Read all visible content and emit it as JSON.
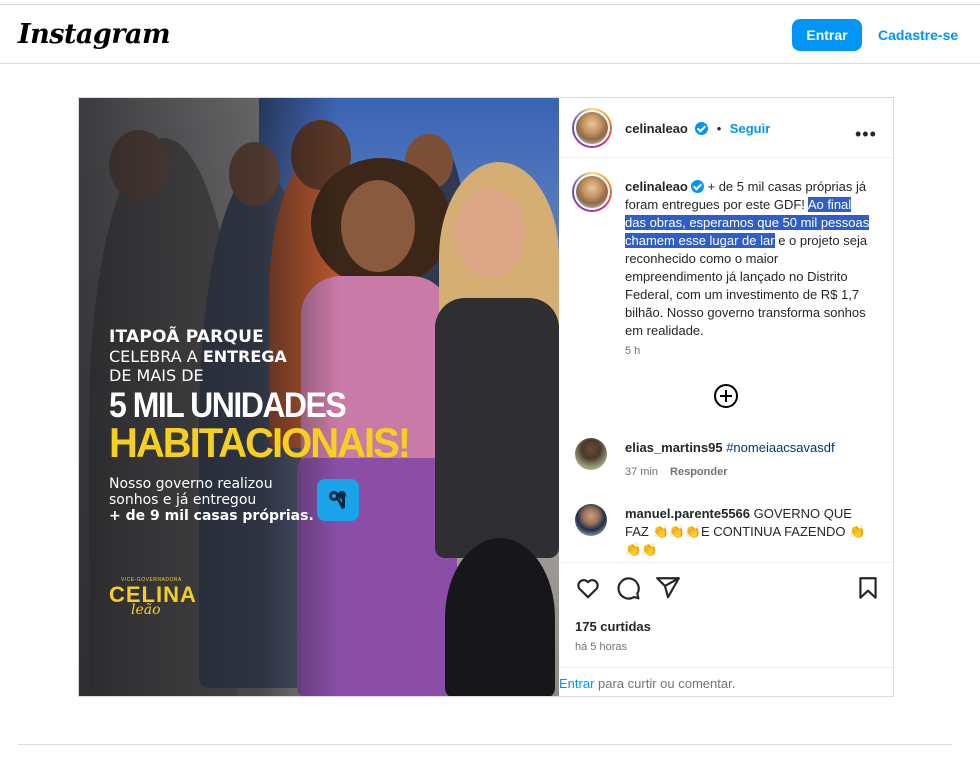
{
  "header": {
    "logo": "Instagram",
    "login_button": "Entrar",
    "signup_link": "Cadastre-se"
  },
  "post": {
    "image_overlay": {
      "line1": "ITAPOÃ PARQUE",
      "line2_prefix": "CELEBRA A ",
      "line2_bold": "ENTREGA",
      "line3": "DE MAIS DE",
      "line4": "5 MIL UNIDADES",
      "line5": "HABITACIONAIS!",
      "line6a": "Nosso governo realizou",
      "line6b": "sonhos e já entregou",
      "line6c": "+ de 9 mil casas próprias.",
      "logo_main": "CELINA",
      "logo_sub": "leão",
      "logo_top": "VICE-GOVERNADORA"
    },
    "author": {
      "username": "celinaleao",
      "follow_label": "Seguir",
      "verified": true
    },
    "more_icon": "more-options-icon",
    "caption": {
      "username": "celinaleao",
      "text_before": "+ de 5 mil casas próprias já foram entregues por este GDF! ",
      "text_highlighted": "Ao final das obras, esperamos que 50 mil pessoas chamem esse lugar de lar",
      "text_after": " e o projeto seja reconhecido como o maior empreendimento já lançado no Distrito Federal, com um investimento de R$ 1,7 bilhão. Nosso governo transforma sonhos em realidade.",
      "time": "5 h"
    },
    "load_more_icon": "plus-circle-icon",
    "comments": [
      {
        "username": "elias_martins95",
        "text": "#nomeiaacsavasdf",
        "time": "37 min",
        "reply_label": "Responder"
      },
      {
        "username": "manuel.parente5566",
        "text": "GOVERNO QUE FAZ 👏👏👏E CONTINUA FAZENDO 👏👏👏"
      }
    ],
    "likes": "175 curtidas",
    "posted_ago": "há 5 horas",
    "login_prompt_link": "Entrar",
    "login_prompt_text": " para curtir ou comentar."
  },
  "colors": {
    "brand_blue": "#0095f6",
    "highlight": "#2f5ec8",
    "overlay_yellow": "#f5d020"
  }
}
